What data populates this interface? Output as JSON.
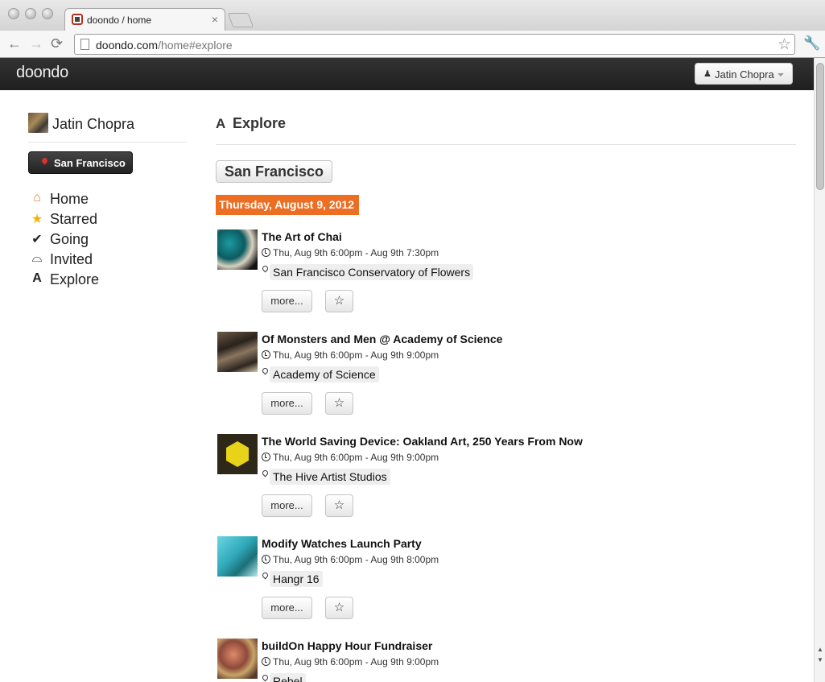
{
  "browser": {
    "tab_title": "doondo / home",
    "tab_close": "×",
    "url_host": "doondo.com",
    "url_path": "/home#explore",
    "back_glyph": "←",
    "forward_glyph": "→",
    "reload_glyph": "⟳",
    "bookmark_glyph": "☆",
    "wrench_glyph": "🔧"
  },
  "navbar": {
    "brand": "doondo",
    "user_menu_label": "Jatin Chopra",
    "user_icon": "user-icon"
  },
  "sidebar": {
    "user_name": "Jatin Chopra",
    "location_button": "San Francisco",
    "items": [
      {
        "label": "Home",
        "icon": "home-icon",
        "glyph": "⌂",
        "color": "#e8752a"
      },
      {
        "label": "Starred",
        "icon": "star-icon",
        "glyph": "★",
        "color": "#f0b20f"
      },
      {
        "label": "Going",
        "icon": "check-icon",
        "glyph": "✔",
        "color": "#111111"
      },
      {
        "label": "Invited",
        "icon": "inbox-icon",
        "glyph": "⌓",
        "color": "#111111"
      },
      {
        "label": "Explore",
        "icon": "road-icon",
        "glyph": "A",
        "color": "#111111"
      }
    ]
  },
  "main": {
    "heading": "Explore",
    "city_button": "San Francisco",
    "date_label": "Thursday, August 9, 2012",
    "more_label": "more...",
    "star_glyph": "☆",
    "events": [
      {
        "title": "The Art of Chai",
        "time": "Thu, Aug 9th 6:00pm - Aug 9th 7:30pm",
        "venue": "San Francisco Conservatory of Flowers"
      },
      {
        "title": "Of Monsters and Men @ Academy of Science",
        "time": "Thu, Aug 9th 6:00pm - Aug 9th 9:00pm",
        "venue": "Academy of Science"
      },
      {
        "title": "The World Saving Device: Oakland Art, 250 Years From Now",
        "time": "Thu, Aug 9th 6:00pm - Aug 9th 9:00pm",
        "venue": "The Hive Artist Studios"
      },
      {
        "title": "Modify Watches Launch Party",
        "time": "Thu, Aug 9th 6:00pm - Aug 9th 8:00pm",
        "venue": "Hangr 16"
      },
      {
        "title": "buildOn Happy Hour Fundraiser",
        "time": "Thu, Aug 9th 6:00pm - Aug 9th 9:00pm",
        "venue": "Rebel"
      }
    ]
  },
  "colors": {
    "date_label_bg": "#ed6d23",
    "navbar_bg": "#222222",
    "location_button_bg": "#333333"
  }
}
